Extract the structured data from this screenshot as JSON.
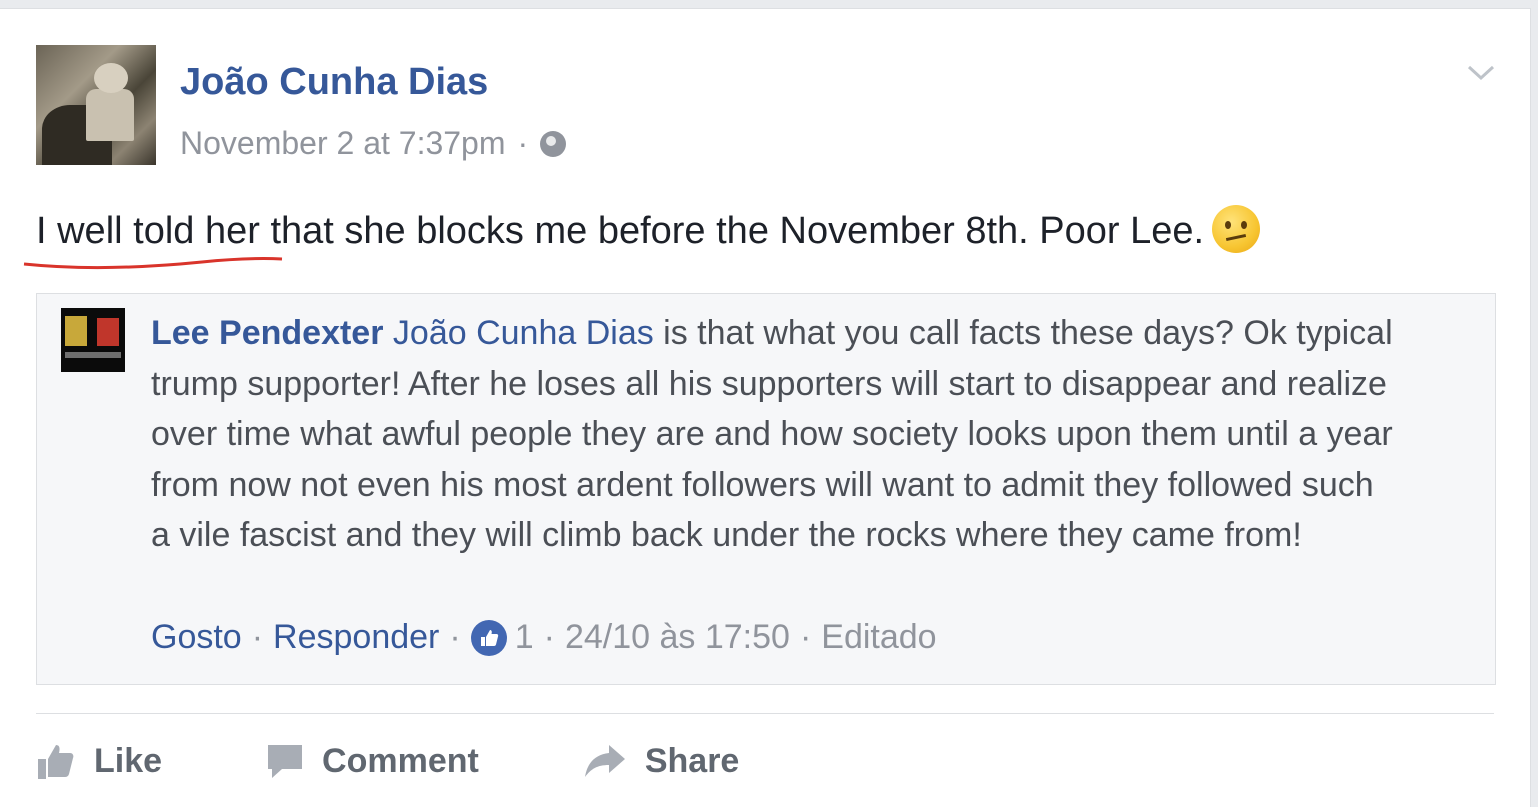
{
  "post": {
    "author": "João Cunha Dias",
    "timestamp": "November 2 at 7:37pm",
    "separator": "·",
    "privacy_icon": "globe-icon",
    "text": "I well told her that she blocks me before the November 8th. Poor Lee.",
    "emoji": "confused-face-emoji",
    "menu_icon": "chevron-down-icon"
  },
  "quoted_comment": {
    "author": "Lee Pendexter",
    "mention": "João Cunha Dias",
    "body": " is that what you call facts these days? Ok typical trump supporter! After he loses all his supporters will start to disappear and realize over time what awful people they are and how society looks upon them until a year from now not even his most ardent followers will want to admit they followed such a vile fascist and they will climb back under the rocks where they came from!",
    "like_label": "Gosto",
    "reply_label": "Responder",
    "like_count": "1",
    "date": "24/10 às 17:50",
    "edited_label": "Editado",
    "separator": "·"
  },
  "actions": {
    "like": "Like",
    "comment": "Comment",
    "share": "Share"
  },
  "colors": {
    "link_blue": "#365899",
    "meta_gray": "#90949c",
    "underline_red": "#d9342b"
  }
}
